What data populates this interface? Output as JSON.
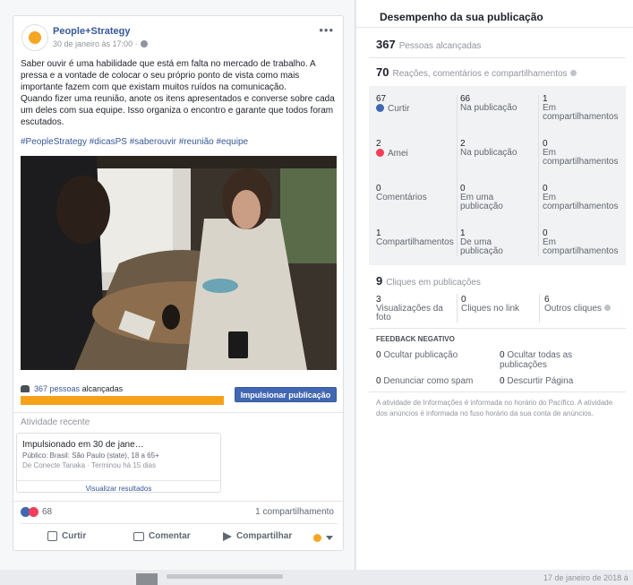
{
  "post": {
    "page_name": "People+Strategy",
    "timestamp": "30 de janeiro às 17:00 ·",
    "text": "Saber ouvir é uma habilidade que está em falta no mercado de trabalho. A pressa e a vontade de colocar o seu próprio ponto de vista como mais importante fazem com que existam muitos ruídos na comunicação.\nQuando fizer uma reunião, anote os itens apresentados e converse sobre cada um deles com sua equipe. Isso organiza o encontro e garante que todos foram escutados.",
    "hashtags": "#PeopleStrategy #dicasPS #saberouvir #reunião #equipe",
    "reach_count": "367 pessoas",
    "reach_suffix": "alcançadas",
    "reach_fill": 1.0,
    "boost_label": "Impulsionar publicação",
    "recent_activity_title": "Atividade recente",
    "activity": {
      "title": "Impulsionado em 30 de jane…",
      "audience": "Público: Brasil: São Paulo (state), 18 a 65+",
      "meta": "De Conecte Tanaka · Terminou há 15 dias",
      "link": "Visualizar resultados"
    },
    "reactions_count": "68",
    "shares": "1 compartilhamento",
    "actions": {
      "like": "Curtir",
      "comment": "Comentar",
      "share": "Compartilhar"
    }
  },
  "performance": {
    "title": "Desempenho da sua publicação",
    "people_reached_num": "367",
    "people_reached_label": "Pessoas alcançadas",
    "engagement_num": "70",
    "engagement_label": "Reações, comentários e compartilhamentos",
    "breakdown": [
      [
        {
          "num": "67",
          "label": "Curtir"
        },
        {
          "num": "66",
          "label": "Na publicação"
        },
        {
          "num": "1",
          "label": "Em compartilhamentos"
        }
      ],
      [
        {
          "num": "2",
          "label": "Amei"
        },
        {
          "num": "2",
          "label": "Na publicação"
        },
        {
          "num": "0",
          "label": "Em compartilhamentos"
        }
      ],
      [
        {
          "num": "0",
          "label": "Comentários"
        },
        {
          "num": "0",
          "label": "Em uma publicação"
        },
        {
          "num": "0",
          "label": "Em compartilhamentos"
        }
      ],
      [
        {
          "num": "1",
          "label": "Compartilhamentos"
        },
        {
          "num": "1",
          "label": "De uma publicação"
        },
        {
          "num": "0",
          "label": "Em compartilhamentos"
        }
      ]
    ],
    "clicks_num": "9",
    "clicks_label": "Cliques em publicações",
    "click_types": [
      {
        "num": "3",
        "label": "Visualizações da foto"
      },
      {
        "num": "0",
        "label": "Cliques no link"
      },
      {
        "num": "6",
        "label": "Outros cliques"
      }
    ],
    "negative_title": "FEEDBACK NEGATIVO",
    "negative": [
      {
        "num": "0",
        "label": "Ocultar publicação"
      },
      {
        "num": "0",
        "label": "Ocultar todas as publicações"
      },
      {
        "num": "0",
        "label": "Denunciar como spam"
      },
      {
        "num": "0",
        "label": "Descurtir Página"
      }
    ],
    "footnote": "A atividade de Informações é informada no horário do Pacífico. A atividade dos anúncios é informada no fuso horário da sua conta de anúncios."
  },
  "background": {
    "date": "17 de janeiro de 2018 à"
  },
  "colors": {
    "accent": "#4267b2",
    "link": "#365899",
    "reach_bar": "#f5a21a",
    "love": "#f33e58"
  }
}
